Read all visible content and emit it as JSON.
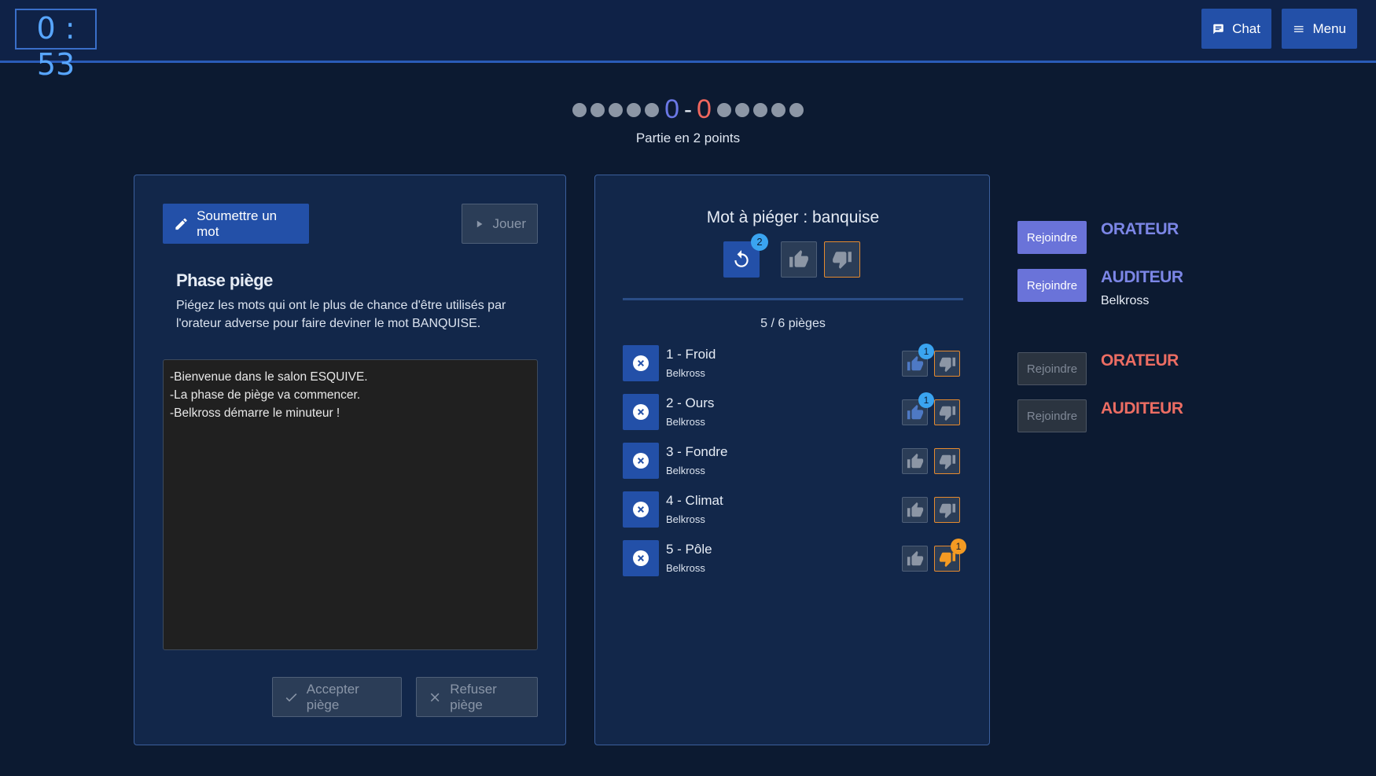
{
  "header": {
    "timer": "0 : 53",
    "chat_label": "Chat",
    "menu_label": "Menu",
    "chat_icon": "chat-icon",
    "menu_icon": "hamburger-icon"
  },
  "score": {
    "team_a": "0",
    "team_b": "0",
    "separator": "-",
    "team_a_dots": 5,
    "team_b_dots": 5,
    "subtitle": "Partie en 2 points",
    "team_a_color": "#6b78e6",
    "team_b_color": "#f0675e"
  },
  "left_panel": {
    "submit_label": "Soumettre un mot",
    "play_label": "Jouer",
    "phase_title": "Phase piège",
    "phase_desc": "Piégez les mots qui ont le plus de chance d'être utilisés par l'orateur adverse pour faire deviner le mot BANQUISE.",
    "log": [
      "-Bienvenue dans le salon ESQUIVE.",
      "-La phase de piège va commencer.",
      "-Belkross démarre le minuteur !"
    ],
    "accept_label": "Accepter piège",
    "refuse_label": "Refuser piège"
  },
  "mid_panel": {
    "target_title": "Mot à piéger : banquise",
    "retry_badge": "2",
    "count": "5 / 6 pièges",
    "traps": [
      {
        "word": "1 - Froid",
        "author": "Belkross",
        "up_badge": "1",
        "down_badge": ""
      },
      {
        "word": "2 - Ours",
        "author": "Belkross",
        "up_badge": "1",
        "down_badge": ""
      },
      {
        "word": "3 - Fondre",
        "author": "Belkross",
        "up_badge": "",
        "down_badge": ""
      },
      {
        "word": "4 - Climat",
        "author": "Belkross",
        "up_badge": "",
        "down_badge": ""
      },
      {
        "word": "5 - Pôle",
        "author": "Belkross",
        "up_badge": "",
        "down_badge": "1"
      }
    ]
  },
  "teams": {
    "join_label": "Rejoindre",
    "blue_orator": "ORATEUR",
    "blue_listener": "AUDITEUR",
    "blue_listener_player": "Belkross",
    "red_orator": "ORATEUR",
    "red_listener": "AUDITEUR"
  }
}
